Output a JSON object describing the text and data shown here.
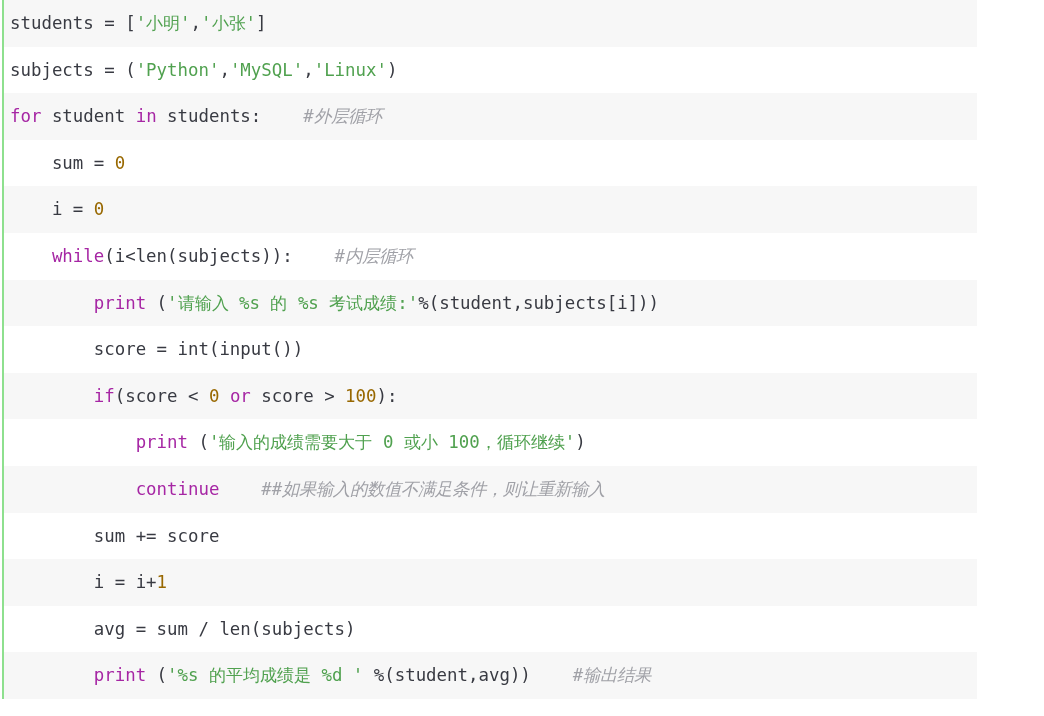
{
  "code_lines": [
    {
      "tokens": [
        {
          "kind": "plain",
          "text": "students = ["
        },
        {
          "kind": "string",
          "text": "'小明'"
        },
        {
          "kind": "plain",
          "text": ","
        },
        {
          "kind": "string",
          "text": "'小张'"
        },
        {
          "kind": "plain",
          "text": "]"
        }
      ]
    },
    {
      "tokens": [
        {
          "kind": "plain",
          "text": "subjects = ("
        },
        {
          "kind": "string",
          "text": "'Python'"
        },
        {
          "kind": "plain",
          "text": ","
        },
        {
          "kind": "string",
          "text": "'MySQL'"
        },
        {
          "kind": "plain",
          "text": ","
        },
        {
          "kind": "string",
          "text": "'Linux'"
        },
        {
          "kind": "plain",
          "text": ")"
        }
      ]
    },
    {
      "tokens": [
        {
          "kind": "keyword",
          "text": "for"
        },
        {
          "kind": "plain",
          "text": " student "
        },
        {
          "kind": "keyword",
          "text": "in"
        },
        {
          "kind": "plain",
          "text": " students:"
        },
        {
          "kind": "comment",
          "text": "#外层循环"
        }
      ],
      "children": [
        {
          "tokens": [
            {
              "kind": "plain",
              "text": "sum = "
            },
            {
              "kind": "number",
              "text": "0"
            }
          ]
        },
        {
          "tokens": [
            {
              "kind": "plain",
              "text": "i = "
            },
            {
              "kind": "number",
              "text": "0"
            }
          ]
        },
        {
          "tokens": [
            {
              "kind": "keyword",
              "text": "while"
            },
            {
              "kind": "plain",
              "text": "(i<len(subjects)):"
            },
            {
              "kind": "comment",
              "text": "#内层循环"
            }
          ],
          "children": [
            {
              "tokens": [
                {
                  "kind": "keyword",
                  "text": "print"
                },
                {
                  "kind": "plain",
                  "text": " ("
                },
                {
                  "kind": "string",
                  "text": "'请输入 %s 的 %s 考试成绩:'"
                },
                {
                  "kind": "plain",
                  "text": "%(student,subjects[i]))"
                }
              ]
            },
            {
              "tokens": [
                {
                  "kind": "plain",
                  "text": "score = int(input())"
                }
              ]
            },
            {
              "tokens": [
                {
                  "kind": "keyword",
                  "text": "if"
                },
                {
                  "kind": "plain",
                  "text": "(score < "
                },
                {
                  "kind": "number",
                  "text": "0"
                },
                {
                  "kind": "keyword",
                  "text": " or"
                },
                {
                  "kind": "plain",
                  "text": " score > "
                },
                {
                  "kind": "number",
                  "text": "100"
                },
                {
                  "kind": "plain",
                  "text": "):"
                }
              ],
              "children": [
                {
                  "tokens": [
                    {
                      "kind": "keyword",
                      "text": "print"
                    },
                    {
                      "kind": "plain",
                      "text": " ("
                    },
                    {
                      "kind": "string",
                      "text": "'输入的成绩需要大于 0 或小 100，循环继续'"
                    },
                    {
                      "kind": "plain",
                      "text": ")"
                    }
                  ]
                },
                {
                  "tokens": [
                    {
                      "kind": "keyword",
                      "text": "continue"
                    },
                    {
                      "kind": "comment",
                      "text": "##如果输入的数值不满足条件，则让重新输入"
                    }
                  ]
                }
              ]
            },
            {
              "tokens": [
                {
                  "kind": "plain",
                  "text": "sum += score"
                }
              ]
            },
            {
              "tokens": [
                {
                  "kind": "plain",
                  "text": "i = i+"
                },
                {
                  "kind": "number",
                  "text": "1"
                }
              ]
            },
            {
              "tokens": [
                {
                  "kind": "plain",
                  "text": "avg = sum / len(subjects)"
                }
              ]
            },
            {
              "tokens": [
                {
                  "kind": "keyword",
                  "text": "print"
                },
                {
                  "kind": "plain",
                  "text": " ("
                },
                {
                  "kind": "string",
                  "text": "'%s 的平均成绩是 %d '"
                },
                {
                  "kind": "plain",
                  "text": " %(student,avg))"
                },
                {
                  "kind": "comment",
                  "text": "#输出结果"
                }
              ]
            }
          ]
        }
      ]
    }
  ]
}
